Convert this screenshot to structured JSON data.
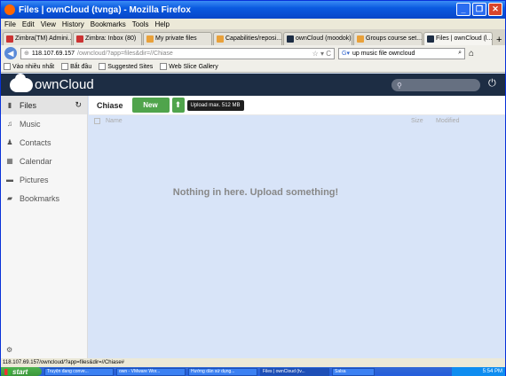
{
  "window": {
    "title": "Files | ownCloud (tvnga) - Mozilla Firefox"
  },
  "menu": [
    "File",
    "Edit",
    "View",
    "History",
    "Bookmarks",
    "Tools",
    "Help"
  ],
  "tabs": [
    {
      "label": "Zimbra(TM) Admini..."
    },
    {
      "label": "Zimbra: Inbox (80)"
    },
    {
      "label": "My private files"
    },
    {
      "label": "Capabilities/reposi..."
    },
    {
      "label": "ownCloud (moodok)"
    },
    {
      "label": "Groups course set..."
    },
    {
      "label": "Files | ownCloud (l..."
    }
  ],
  "address": {
    "host": "118.107.69.157",
    "path": "/owncloud/?app=files&dir=//Chiase"
  },
  "search_box": {
    "value": "up music file owncloud"
  },
  "bookmarks": [
    "Vào nhiều nhất",
    "Bắt đầu",
    "Suggested Sites",
    "Web Slice Gallery"
  ],
  "brand": "ownCloud",
  "sidebar": [
    {
      "label": "Files",
      "icon": "folder-icon"
    },
    {
      "label": "Music",
      "icon": "music-icon"
    },
    {
      "label": "Contacts",
      "icon": "contacts-icon"
    },
    {
      "label": "Calendar",
      "icon": "calendar-icon"
    },
    {
      "label": "Pictures",
      "icon": "pictures-icon"
    },
    {
      "label": "Bookmarks",
      "icon": "bookmarks-icon"
    }
  ],
  "controls": {
    "breadcrumb": "Chiase",
    "new_label": "New",
    "upload_tooltip": "Upload max. 512 MB"
  },
  "table": {
    "name_header": "Name",
    "size_header": "Size",
    "modified_header": "Modified"
  },
  "empty_message": "Nothing in here. Upload something!",
  "status": "118.107.69.157/owncloud/?app=files&dir=//Chiase#",
  "taskbar": {
    "start": "start",
    "items": [
      "Truyện đang conve...",
      "own - VMware Wor...",
      "Hướng dẫn sử dụng...",
      "Files | ownCloud (tv...",
      "Salsa"
    ],
    "clock": "5:54 PM"
  },
  "colors": {
    "header": "#1d2d44",
    "new_button": "#50a44c"
  }
}
